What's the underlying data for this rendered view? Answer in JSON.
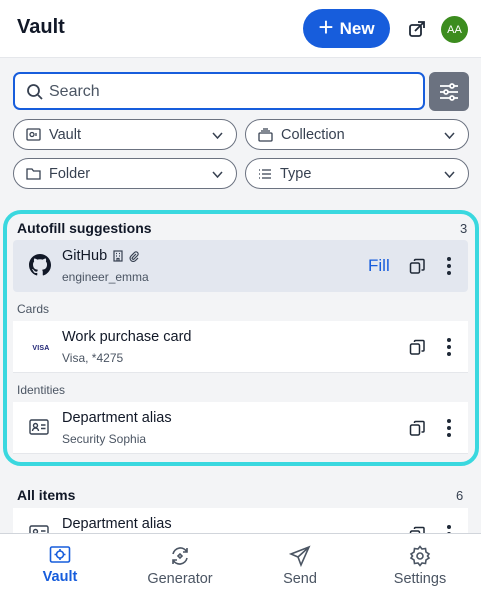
{
  "header": {
    "title": "Vault",
    "new_label": "New",
    "avatar_initials": "AA",
    "avatar_color": "#3c8c1e",
    "accent_color": "#175ddc"
  },
  "search": {
    "placeholder": "Search",
    "value": ""
  },
  "filters": [
    {
      "label": "Vault",
      "icon": "vault-icon"
    },
    {
      "label": "Collection",
      "icon": "collection-icon"
    },
    {
      "label": "Folder",
      "icon": "folder-icon"
    },
    {
      "label": "Type",
      "icon": "list-icon"
    }
  ],
  "autofill": {
    "title": "Autofill suggestions",
    "count": "3",
    "highlight_color": "#3ad8df",
    "items": [
      {
        "name": "GitHub",
        "subtitle": "engineer_emma",
        "action": "Fill",
        "icon": "github-icon",
        "badges": [
          "organization-icon",
          "attachment-icon"
        ]
      }
    ],
    "groups": [
      {
        "label": "Cards",
        "items": [
          {
            "name": "Work purchase card",
            "subtitle": "Visa, *4275",
            "icon": "visa-icon",
            "brand": "VISA"
          }
        ]
      },
      {
        "label": "Identities",
        "items": [
          {
            "name": "Department alias",
            "subtitle": "Security Sophia",
            "icon": "id-card-icon"
          }
        ]
      }
    ]
  },
  "all_items": {
    "title": "All items",
    "count": "6",
    "items": [
      {
        "name": "Department alias",
        "icon": "id-card-icon"
      }
    ]
  },
  "nav": [
    {
      "label": "Vault",
      "icon": "vault-icon",
      "active": true
    },
    {
      "label": "Generator",
      "icon": "generator-icon",
      "active": false
    },
    {
      "label": "Send",
      "icon": "send-icon",
      "active": false
    },
    {
      "label": "Settings",
      "icon": "gear-icon",
      "active": false
    }
  ]
}
